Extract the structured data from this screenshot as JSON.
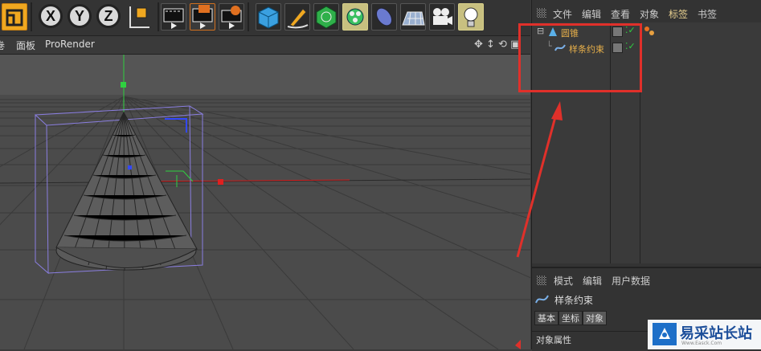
{
  "viewport_menu": {
    "items": [
      "卷",
      "面板",
      "ProRender"
    ]
  },
  "toolbar": {
    "axis_buttons": [
      "X",
      "Y",
      "Z"
    ],
    "icons": [
      "make-editable-icon",
      "render-view-icon",
      "render-picture-queue-icon",
      "render-settings-icon",
      "cube-icon",
      "pen-icon",
      "subdivision-icon",
      "cloner-icon",
      "deformer-icon",
      "floor-icon",
      "camera-icon",
      "light-icon"
    ]
  },
  "object_manager": {
    "menu": [
      "文件",
      "编辑",
      "查看",
      "对象",
      "标签",
      "书签"
    ],
    "objects": [
      {
        "name": "圆锥",
        "icon": "cone-icon"
      },
      {
        "name": "样条约束",
        "icon": "spline-constraint-icon"
      }
    ]
  },
  "attribute_manager": {
    "menu": [
      "模式",
      "编辑",
      "用户数据"
    ],
    "object_name": "样条约束",
    "tabs": [
      "基本",
      "坐标",
      "对象"
    ],
    "section": "对象属性"
  },
  "watermark": {
    "text": "易采站长站",
    "sub": "Www.Easck.Com"
  },
  "colors": {
    "highlight": "#e0302a",
    "active_text": "#e8b04a",
    "toolbar_selected": "#c8c080"
  }
}
